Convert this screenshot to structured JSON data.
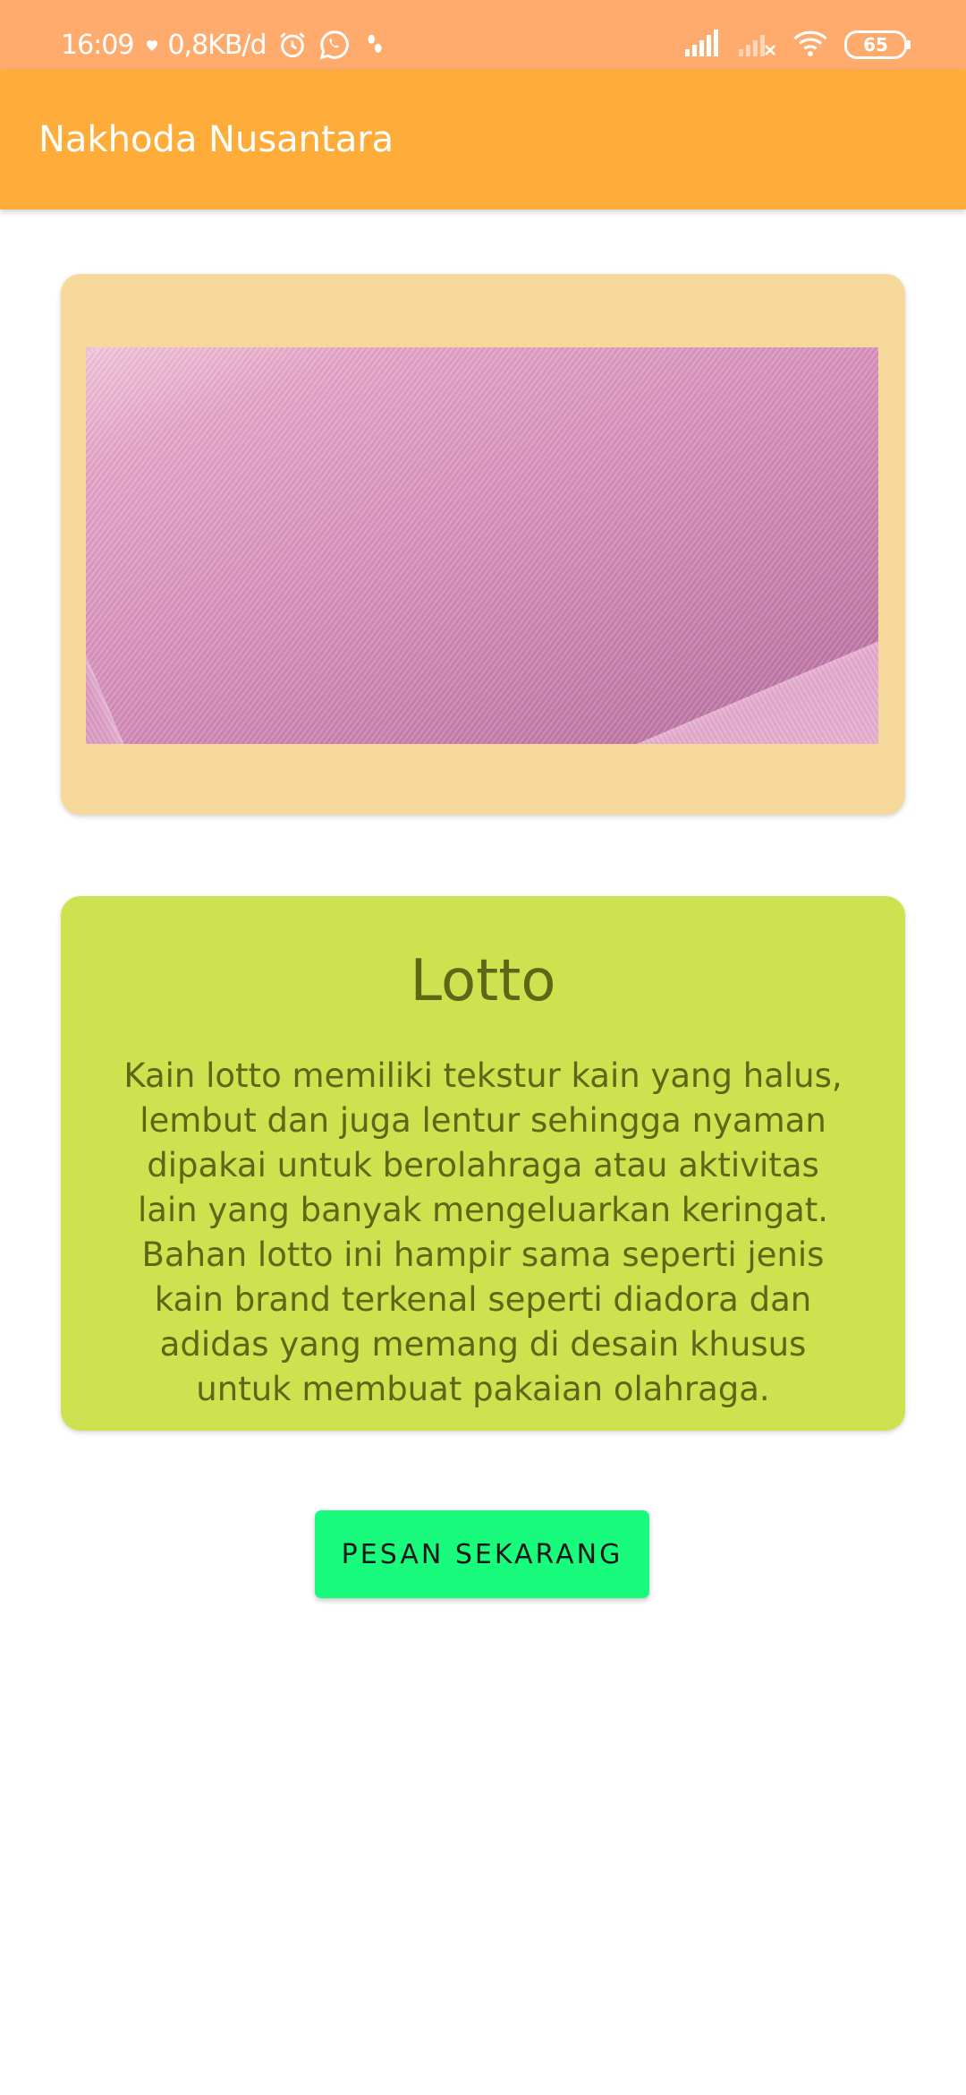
{
  "status_bar": {
    "time": "16:09",
    "speed": "0,8KB/d",
    "battery": "65",
    "icons": [
      "heart-icon",
      "alarm-icon",
      "whatsapp-icon",
      "footprint-icon",
      "signal-icon",
      "signal-no-service-icon",
      "wifi-icon",
      "battery-icon"
    ]
  },
  "app_bar": {
    "title": "Nakhoda Nusantara"
  },
  "product": {
    "title": "Lotto",
    "description": "Kain lotto memiliki tekstur kain yang halus, lembut dan juga lentur sehingga nyaman dipakai untuk berolahraga atau aktivitas lain yang banyak mengeluarkan keringat. Bahan lotto ini hampir sama seperti jenis kain brand terkenal seperti diadora dan adidas yang memang di desain khusus untuk membuat pakaian olahraga."
  },
  "actions": {
    "order_label": "PESAN SEKARANG"
  },
  "colors": {
    "status_bar": "#FFAB6E",
    "app_bar": "#FFAD3A",
    "image_card": "#F7D89C",
    "info_card": "#CDE24E",
    "info_text": "#5E6617",
    "order_button": "#19FB7D"
  }
}
